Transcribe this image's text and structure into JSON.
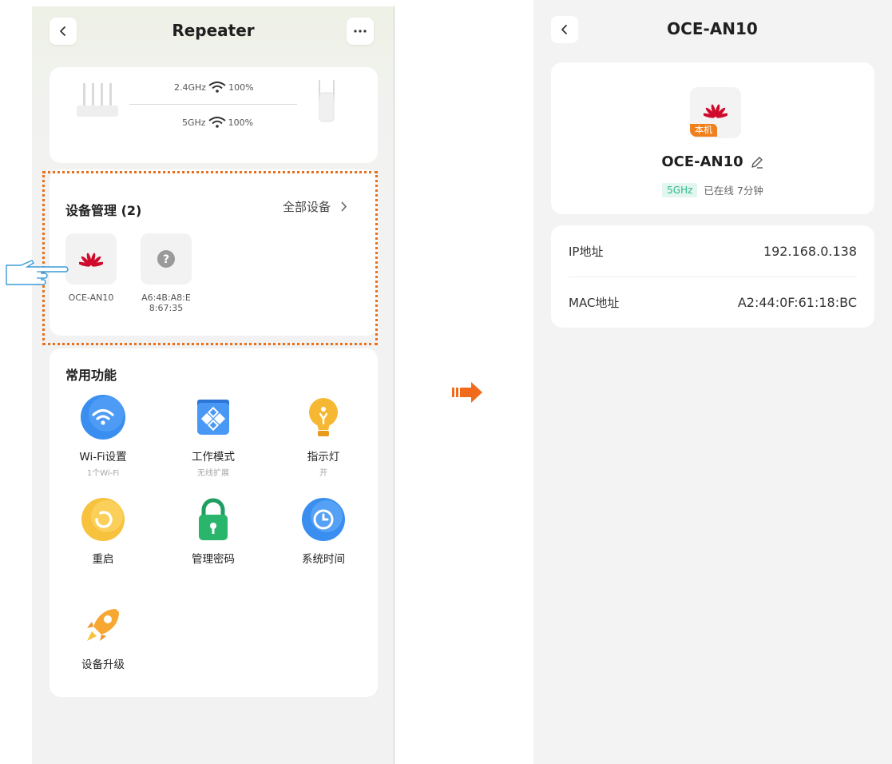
{
  "left": {
    "title": "Repeater",
    "topology": {
      "band24_label": "2.4GHz",
      "band24_signal": "100%",
      "band5_label": "5GHz",
      "band5_signal": "100%"
    },
    "device_management": {
      "title": "设备管理 (2)",
      "all_devices_label": "全部设备",
      "devices": [
        {
          "name": "OCE-AN10",
          "icon": "huawei-logo-icon"
        },
        {
          "name_line1": "A6:4B:A8:E",
          "name_line2": "8:67:35",
          "icon": "question-mark-icon"
        }
      ]
    },
    "common_functions": {
      "title": "常用功能",
      "items": [
        {
          "label": "Wi-Fi设置",
          "sub": "1个Wi-Fi",
          "icon": "wifi-icon"
        },
        {
          "label": "工作模式",
          "sub": "无线扩展",
          "icon": "work-mode-icon"
        },
        {
          "label": "指示灯",
          "sub": "开",
          "icon": "bulb-icon"
        },
        {
          "label": "重启",
          "sub": "",
          "icon": "restart-icon"
        },
        {
          "label": "管理密码",
          "sub": "",
          "icon": "lock-icon"
        },
        {
          "label": "系统时间",
          "sub": "",
          "icon": "clock-icon"
        },
        {
          "label": "设备升级",
          "sub": "",
          "icon": "rocket-icon"
        }
      ]
    }
  },
  "right": {
    "title": "OCE-AN10",
    "device": {
      "badge": "本机",
      "name": "OCE-AN10",
      "band": "5GHz",
      "status": "已在线 7分钟"
    },
    "info": [
      {
        "label": "IP地址",
        "value": "192.168.0.138"
      },
      {
        "label": "MAC地址",
        "value": "A2:44:0F:61:18:BC"
      }
    ]
  },
  "colors": {
    "highlight": "#e8701a",
    "arrow": "#f26b1d",
    "band_bg": "#e2f6ef",
    "band_text": "#2cb78a",
    "badge": "#f0801d",
    "huawei": "#cf0a2c"
  }
}
